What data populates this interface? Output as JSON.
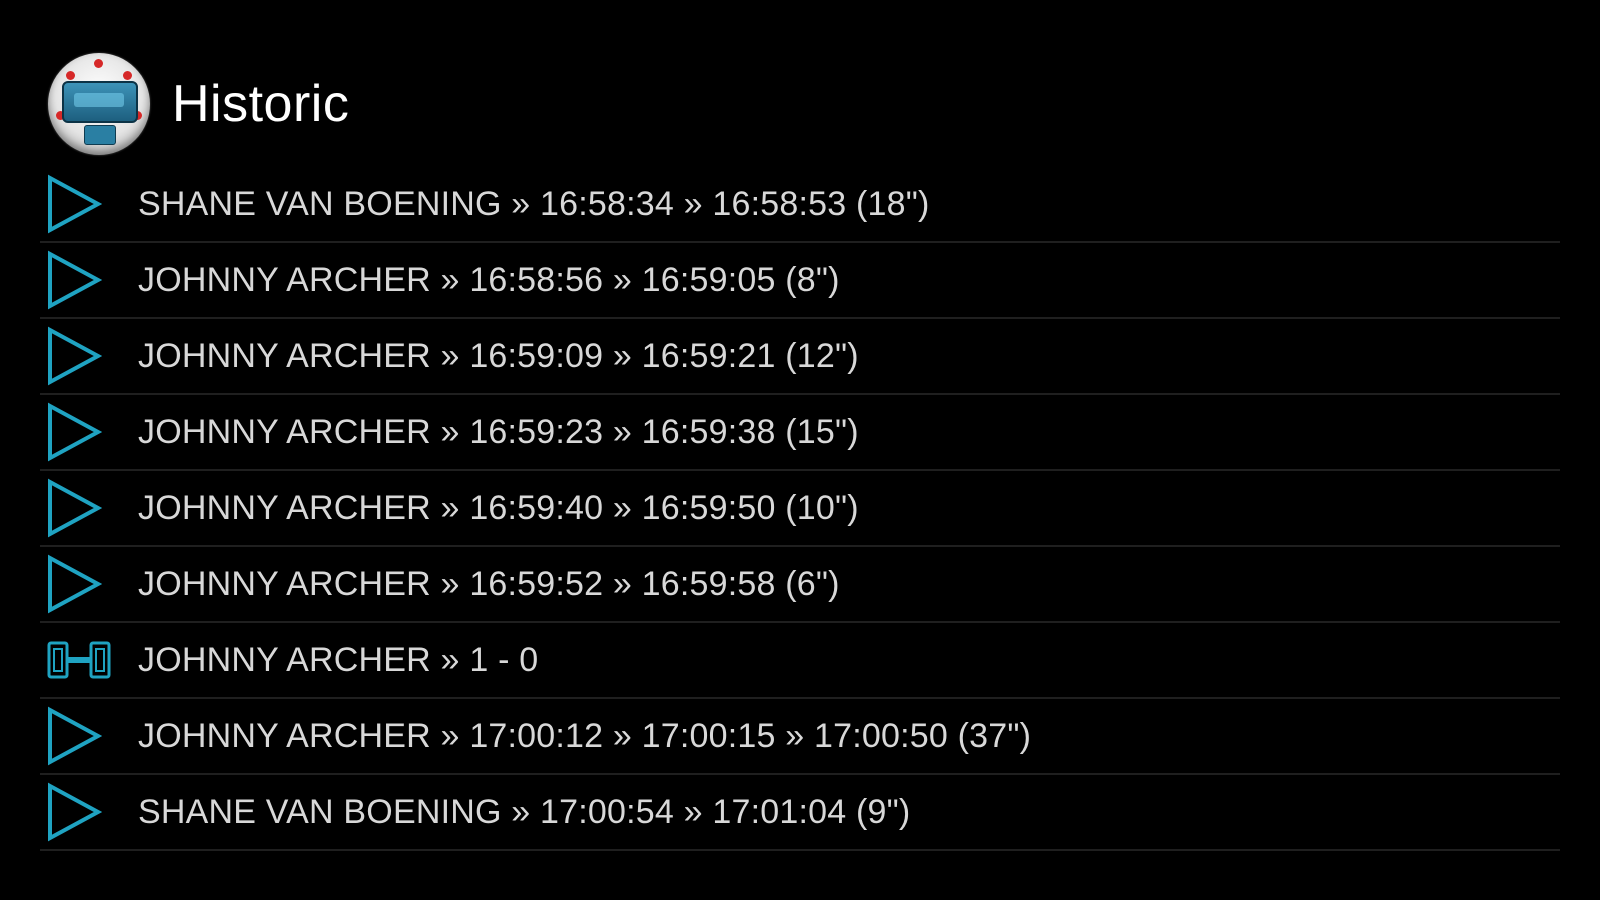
{
  "header": {
    "title": "Historic",
    "app_icon": "scoreboard-app-icon"
  },
  "colors": {
    "background": "#000000",
    "accent": "#1fa3c2",
    "text": "#d8d8d8",
    "divider": "#1f1f1f"
  },
  "rows": [
    {
      "icon": "play-icon",
      "text": "SHANE VAN BOENING » 16:58:34 » 16:58:53 (18\")"
    },
    {
      "icon": "play-icon",
      "text": "JOHNNY ARCHER » 16:58:56 » 16:59:05 (8\")"
    },
    {
      "icon": "play-icon",
      "text": "JOHNNY ARCHER » 16:59:09 » 16:59:21 (12\")"
    },
    {
      "icon": "play-icon",
      "text": "JOHNNY ARCHER » 16:59:23 » 16:59:38 (15\")"
    },
    {
      "icon": "play-icon",
      "text": "JOHNNY ARCHER » 16:59:40 » 16:59:50 (10\")"
    },
    {
      "icon": "play-icon",
      "text": "JOHNNY ARCHER » 16:59:52 » 16:59:58 (6\")"
    },
    {
      "icon": "score-icon",
      "text": "JOHNNY ARCHER » 1 - 0"
    },
    {
      "icon": "play-icon",
      "text": "JOHNNY ARCHER » 17:00:12 » 17:00:15 » 17:00:50 (37\")"
    },
    {
      "icon": "play-icon",
      "text": "SHANE VAN BOENING » 17:00:54 » 17:01:04 (9\")"
    }
  ]
}
